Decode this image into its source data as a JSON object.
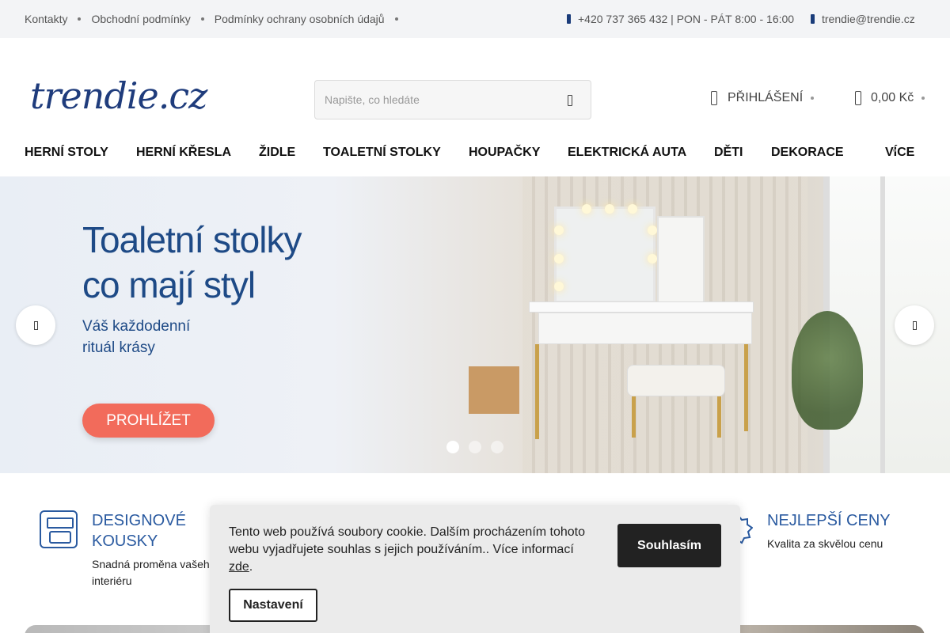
{
  "topbar": {
    "links": [
      "Kontakty",
      "Obchodní podmínky",
      "Podmínky ochrany osobních údajů"
    ],
    "phone": "+420 737 365 432 | PON - PÁT 8:00 - 16:00",
    "email": "trendie@trendie.cz"
  },
  "header": {
    "logo": "trendie.cz",
    "search_placeholder": "Napište, co hledáte",
    "login_label": "PŘIHLÁŠENÍ",
    "cart_total": "0,00 Kč"
  },
  "nav": {
    "items": [
      "HERNÍ STOLY",
      "HERNÍ KŘESLA",
      "ŽIDLE",
      "TOALETNÍ STOLKY",
      "HOUPAČKY",
      "ELEKTRICKÁ AUTA",
      "DĚTI",
      "DEKORACE"
    ],
    "more": "VÍCE"
  },
  "hero": {
    "title_line1": "Toaletní stolky",
    "title_line2": "co mají styl",
    "subtitle_line1": "Váš každodenní",
    "subtitle_line2": "rituál krásy",
    "button": "PROHLÍŽET",
    "slide_count": 3,
    "active_slide": 1
  },
  "features": [
    {
      "title_line1": "DESIGNOVÉ",
      "title_line2": "KOUSKY",
      "text_line1": "Snadná proměna vašeho",
      "text_line2": "interiéru"
    },
    {
      "title_line1": "NEJLEPŠÍ CENY",
      "text_line1": "Kvalita za skvělou cenu"
    }
  ],
  "cookie": {
    "text": "Tento web používá soubory cookie. Dalším procházením tohoto webu vyjadřujete souhlas s jejich používáním.. Více informací",
    "link": "zde",
    "after_link": ".",
    "agree_button": "Souhlasím",
    "settings_button": "Nastavení"
  },
  "colors": {
    "brand_blue": "#1f3c7c",
    "hero_blue": "#1e4a86",
    "cta_coral": "#f26b5b",
    "feature_blue": "#2a5aa0"
  }
}
